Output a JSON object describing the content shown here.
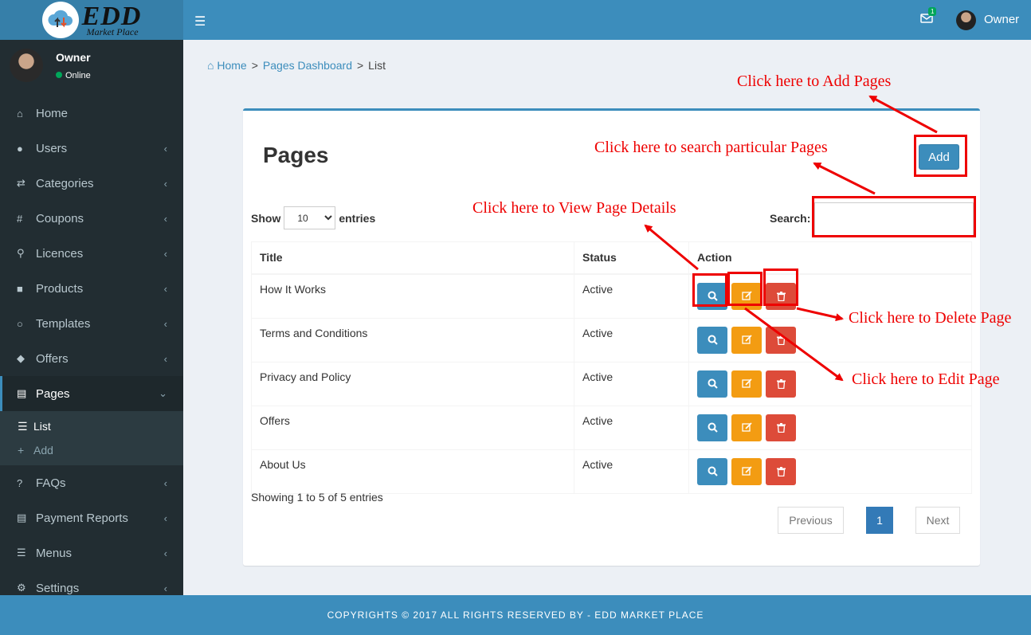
{
  "brand": {
    "name": "EDD",
    "tagline": "Market Place"
  },
  "header": {
    "notification_count": "1",
    "username": "Owner"
  },
  "user_panel": {
    "name": "Owner",
    "status": "Online"
  },
  "sidebar": {
    "items": [
      {
        "label": "Home",
        "icon": "home-icon"
      },
      {
        "label": "Users",
        "icon": "users-icon"
      },
      {
        "label": "Categories",
        "icon": "shuffle-icon"
      },
      {
        "label": "Coupons",
        "icon": "hash-icon"
      },
      {
        "label": "Licences",
        "icon": "key-icon"
      },
      {
        "label": "Products",
        "icon": "bag-icon"
      },
      {
        "label": "Templates",
        "icon": "comment-icon"
      },
      {
        "label": "Offers",
        "icon": "tags-icon"
      },
      {
        "label": "Pages",
        "icon": "file-icon"
      },
      {
        "label": "FAQs",
        "icon": "question-icon"
      },
      {
        "label": "Payment Reports",
        "icon": "file-icon"
      },
      {
        "label": "Menus",
        "icon": "menu-icon"
      },
      {
        "label": "Settings",
        "icon": "gear-icon"
      }
    ],
    "pages_sub": [
      {
        "label": "List"
      },
      {
        "label": "Add"
      }
    ]
  },
  "breadcrumb": {
    "home": "Home",
    "dashboard": "Pages Dashboard",
    "current": "List"
  },
  "box": {
    "title": "Pages",
    "add_label": "Add"
  },
  "table_controls": {
    "show_label": "Show",
    "entries_value": "10",
    "entries_label": "entries",
    "search_label": "Search:"
  },
  "table": {
    "headers": [
      "Title",
      "Status",
      "Action"
    ],
    "rows": [
      {
        "title": "How It Works",
        "status": "Active"
      },
      {
        "title": "Terms and Conditions",
        "status": "Active"
      },
      {
        "title": "Privacy and Policy",
        "status": "Active"
      },
      {
        "title": "Offers",
        "status": "Active"
      },
      {
        "title": "About Us",
        "status": "Active"
      }
    ]
  },
  "pagination": {
    "info": "Showing 1 to 5 of 5 entries",
    "previous": "Previous",
    "current": "1",
    "next": "Next"
  },
  "footer": {
    "text": "COPYRIGHTS © 2017 ALL RIGHTS RESERVED BY - EDD MARKET PLACE"
  },
  "annotations": {
    "add": "Click here to Add Pages",
    "search": "Click here to search particular Pages",
    "view": "Click here to View Page Details",
    "delete": "Click here to Delete Page",
    "edit": "Click here to Edit Page"
  },
  "colors": {
    "primary": "#3c8dbc",
    "sidebar": "#222d32",
    "warning": "#f39c12",
    "danger": "#dd4b39",
    "annotation": "#ee0000"
  }
}
